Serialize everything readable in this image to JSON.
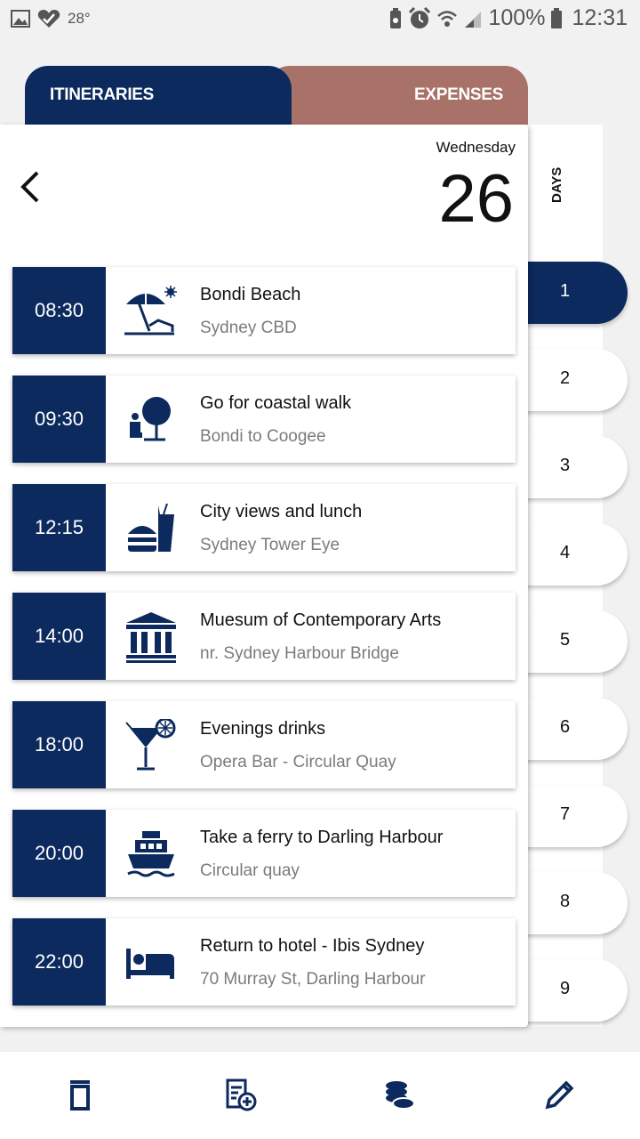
{
  "status": {
    "temperature": "28°",
    "battery": "100%",
    "time": "12:31"
  },
  "tabs": {
    "itineraries": "ITINERARIES",
    "expenses": "EXPENSES"
  },
  "header": {
    "weekday": "Wednesday",
    "day_number": "26"
  },
  "days": {
    "label": "DAYS",
    "items": [
      "1",
      "2",
      "3",
      "4",
      "5",
      "6",
      "7",
      "8",
      "9"
    ],
    "active": "1"
  },
  "itinerary": [
    {
      "time": "08:30",
      "title": "Bondi Beach",
      "subtitle": "Sydney CBD",
      "icon": "beach-umbrella-icon"
    },
    {
      "time": "09:30",
      "title": "Go for coastal walk",
      "subtitle": "Bondi to Coogee",
      "icon": "park-walk-icon"
    },
    {
      "time": "12:15",
      "title": "City views and lunch",
      "subtitle": "Sydney Tower Eye",
      "icon": "fast-food-icon"
    },
    {
      "time": "14:00",
      "title": "Muesum of Contemporary Arts",
      "subtitle": "nr. Sydney Harbour Bridge",
      "icon": "museum-icon"
    },
    {
      "time": "18:00",
      "title": "Evenings drinks",
      "subtitle": "Opera Bar - Circular Quay",
      "icon": "cocktail-icon"
    },
    {
      "time": "20:00",
      "title": "Take a ferry to Darling Harbour",
      "subtitle": "Circular quay",
      "icon": "ferry-icon"
    },
    {
      "time": "22:00",
      "title": "Return to hotel - Ibis Sydney",
      "subtitle": "70 Murray St, Darling Harbour",
      "icon": "hotel-bed-icon"
    }
  ],
  "bottom_bar": {
    "buttons": [
      "delete-icon",
      "add-to-list-icon",
      "coins-icon",
      "edit-pencil-icon"
    ]
  },
  "colors": {
    "navy": "#0d2a5e",
    "expenses_tab": "#a97268",
    "subtitle_gray": "#7b7b7b"
  }
}
